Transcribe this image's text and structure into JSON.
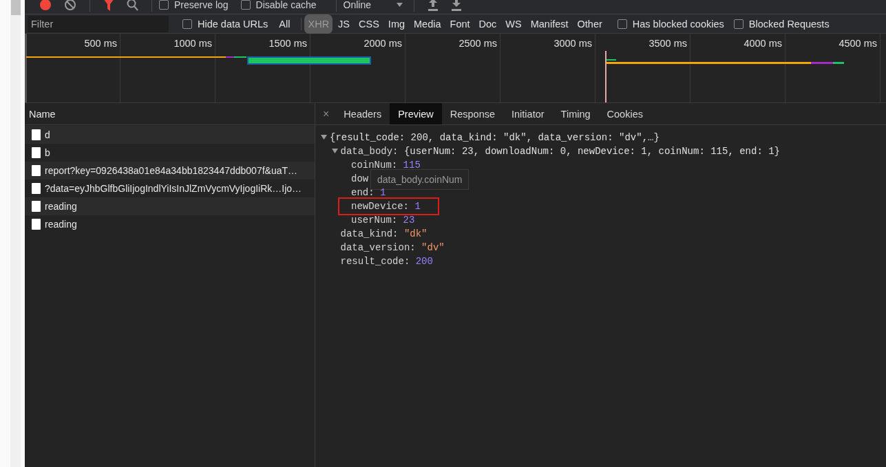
{
  "toolbar": {
    "recording": true,
    "checkboxes": [
      {
        "label": "Preserve log",
        "checked": false
      },
      {
        "label": "Disable cache",
        "checked": false
      }
    ],
    "throttling": "Online"
  },
  "filter": {
    "placeholder": "Filter",
    "hide_data_urls": {
      "label": "Hide data URLs",
      "checked": false
    },
    "types": [
      {
        "label": "All",
        "selected": false
      },
      {
        "label": "XHR",
        "selected": true
      },
      {
        "label": "JS",
        "selected": false
      },
      {
        "label": "CSS",
        "selected": false
      },
      {
        "label": "Img",
        "selected": false
      },
      {
        "label": "Media",
        "selected": false
      },
      {
        "label": "Font",
        "selected": false
      },
      {
        "label": "Doc",
        "selected": false
      },
      {
        "label": "WS",
        "selected": false
      },
      {
        "label": "Manifest",
        "selected": false
      },
      {
        "label": "Other",
        "selected": false
      }
    ],
    "options": [
      {
        "label": "Has blocked cookies",
        "checked": false
      },
      {
        "label": "Blocked Requests",
        "checked": false
      }
    ]
  },
  "overview": {
    "ticks": [
      "500 ms",
      "1000 ms",
      "1500 ms",
      "2000 ms",
      "2500 ms",
      "3000 ms",
      "3500 ms",
      "4000 ms",
      "4500 ms"
    ]
  },
  "requests": {
    "column": "Name",
    "rows": [
      {
        "name": "d"
      },
      {
        "name": "b"
      },
      {
        "name": "report?key=0926438a01e84a34bb1823447ddb007f&uaT…"
      },
      {
        "name": "?data=eyJhbGlfbGliIjogIndlYiIsInJlZmVycmVyIjogIiRk…Ijo…"
      },
      {
        "name": "reading"
      },
      {
        "name": "reading"
      }
    ]
  },
  "details": {
    "close": "×",
    "tabs": [
      {
        "label": "Headers",
        "selected": false
      },
      {
        "label": "Preview",
        "selected": true
      },
      {
        "label": "Response",
        "selected": false
      },
      {
        "label": "Initiator",
        "selected": false
      },
      {
        "label": "Timing",
        "selected": false
      },
      {
        "label": "Cookies",
        "selected": false
      }
    ],
    "preview": {
      "summary": "{result_code: 200, data_kind: \"dk\", data_version: \"dv\",…}",
      "expanded": true,
      "children": [
        {
          "key": "data_body:",
          "summary": "{userNum: 23, downloadNum: 0, newDevice: 1, coinNum: 115, end: 1}",
          "expanded": true,
          "children": [
            {
              "key": "coinNum:",
              "value": "115",
              "kind": "number"
            },
            {
              "key": "dow",
              "tooltip": "data_body.coinNum"
            },
            {
              "key": "end:",
              "value": "1",
              "kind": "number"
            },
            {
              "key": "newDevice:",
              "value": "1",
              "kind": "number",
              "highlighted": true
            },
            {
              "key": "userNum:",
              "value": "23",
              "kind": "number"
            }
          ]
        },
        {
          "key": "data_kind:",
          "value": "\"dk\"",
          "kind": "string"
        },
        {
          "key": "data_version:",
          "value": "\"dv\"",
          "kind": "string"
        },
        {
          "key": "result_code:",
          "value": "200",
          "kind": "number"
        }
      ]
    }
  }
}
